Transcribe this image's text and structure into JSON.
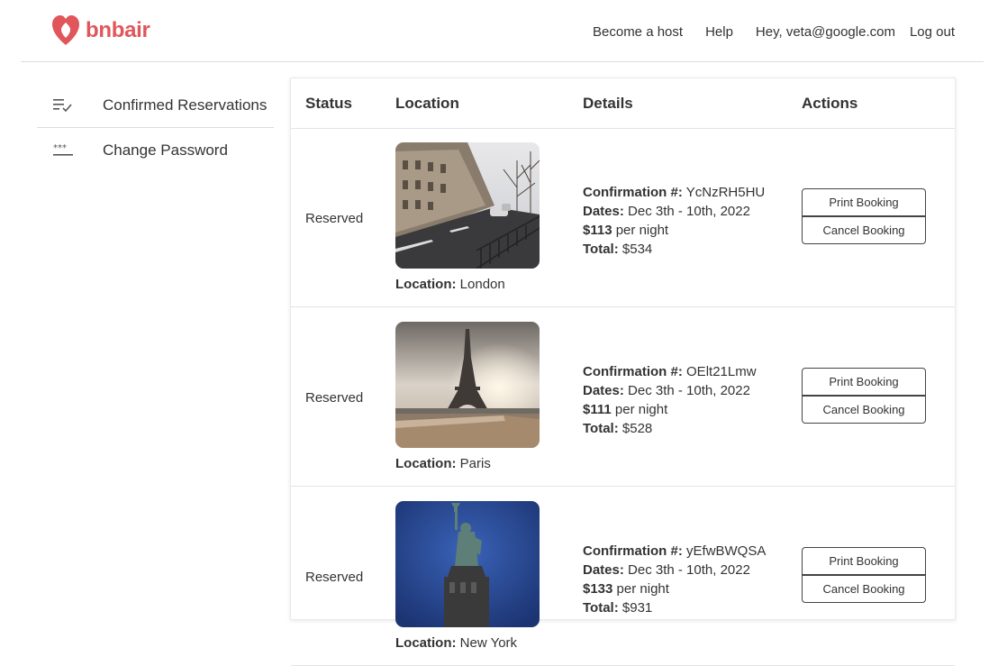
{
  "brand": {
    "name": "bnbair",
    "color": "#e0565b"
  },
  "nav": {
    "become_host": "Become a host",
    "help": "Help",
    "greeting": "Hey, veta@google.com",
    "logout": "Log out"
  },
  "sidebar": {
    "items": [
      {
        "label": "Confirmed Reservations",
        "icon": "checklist-icon"
      },
      {
        "label": "Change Password",
        "icon": "password-icon"
      }
    ]
  },
  "table": {
    "headers": {
      "status": "Status",
      "location": "Location",
      "details": "Details",
      "actions": "Actions"
    },
    "labels": {
      "location": "Location:",
      "confirmation": "Confirmation #:",
      "dates": "Dates:",
      "per_night": "per night",
      "total": "Total:",
      "print": "Print Booking",
      "cancel": "Cancel Booking"
    },
    "rows": [
      {
        "status": "Reserved",
        "location": "London",
        "confirmation": "YcNzRH5HU",
        "dates": "Dec 3th - 10th, 2022",
        "price": "$113",
        "total": "$534"
      },
      {
        "status": "Reserved",
        "location": "Paris",
        "confirmation": "OElt21Lmw",
        "dates": "Dec 3th - 10th, 2022",
        "price": "$111",
        "total": "$528"
      },
      {
        "status": "Reserved",
        "location": "New York",
        "confirmation": "yEfwBWQSA",
        "dates": "Dec 3th - 10th, 2022",
        "price": "$133",
        "total": "$931"
      }
    ]
  }
}
